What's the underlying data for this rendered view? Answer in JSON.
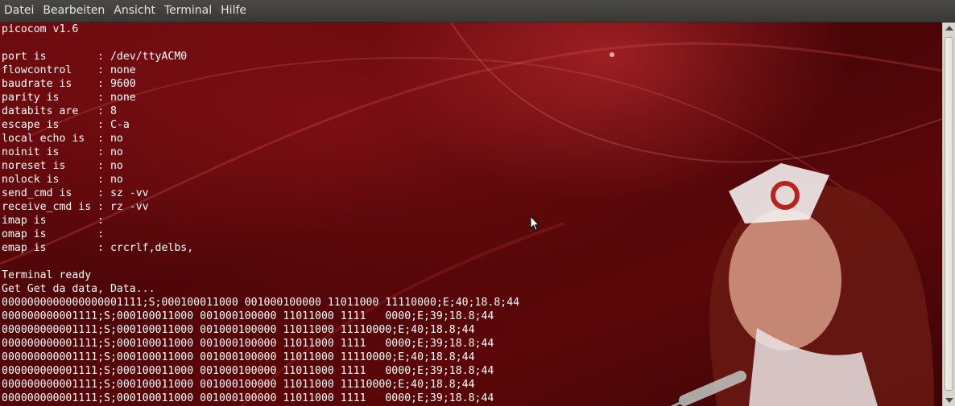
{
  "menu": [
    "Datei",
    "Bearbeiten",
    "Ansicht",
    "Terminal",
    "Hilfe"
  ],
  "terminal": {
    "lines": [
      "picocom v1.6",
      "",
      "port is        : /dev/ttyACM0",
      "flowcontrol    : none",
      "baudrate is    : 9600",
      "parity is      : none",
      "databits are   : 8",
      "escape is      : C-a",
      "local echo is  : no",
      "noinit is      : no",
      "noreset is     : no",
      "nolock is      : no",
      "send_cmd is    : sz -vv",
      "receive_cmd is : rz -vv",
      "imap is        :",
      "omap is        :",
      "emap is        : crcrlf,delbs,",
      "",
      "Terminal ready",
      "Get Get da data, Data...",
      "0000000000000000001111;S;000100011000 001000100000 11011000 11110000;E;40;18.8;44",
      "000000000001111;S;000100011000 001000100000 11011000 1111   0000;E;39;18.8;44",
      "000000000001111;S;000100011000 001000100000 11011000 11110000;E;40;18.8;44",
      "000000000001111;S;000100011000 001000100000 11011000 1111   0000;E;39;18.8;44",
      "000000000001111;S;000100011000 001000100000 11011000 11110000;E;40;18.8;44",
      "000000000001111;S;000100011000 001000100000 11011000 1111   0000;E;39;18.8;44",
      "000000000001111;S;000100011000 001000100000 11011000 11110000;E;40;18.8;44",
      "000000000001111;S;000100011000 001000100000 11011000 1111   0000;E;39;18.8;44"
    ]
  },
  "colors": {
    "terminal_bg": "#5a0608",
    "terminal_text": "#ffffff",
    "menubar_bg": "#3f3d39",
    "menubar_text": "#e6e4df"
  },
  "icons": [
    "mouse-pointer-icon",
    "scroll-up-arrow-icon",
    "scroll-down-arrow-icon"
  ]
}
